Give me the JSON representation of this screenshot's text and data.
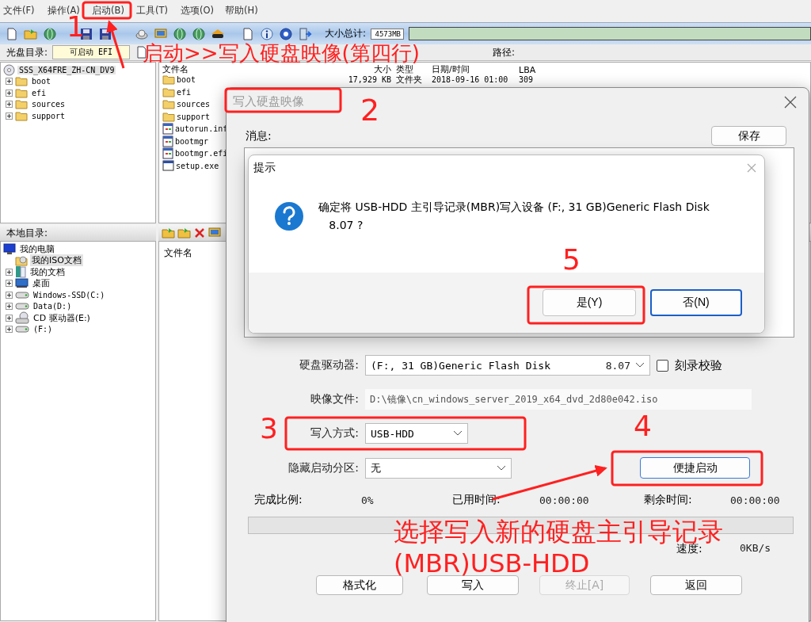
{
  "menu": [
    {
      "label": "文件(F)"
    },
    {
      "label": "操作(A)"
    },
    {
      "label": "启动(B)"
    },
    {
      "label": "工具(T)"
    },
    {
      "label": "选项(O)"
    },
    {
      "label": "帮助(H)"
    }
  ],
  "toolbar": {
    "size_label": "大小总计:",
    "size_value": "4573MB"
  },
  "cd_bar": {
    "label": "光盘目录:",
    "value": "可启动 EFI",
    "path_label": "路径:"
  },
  "iso_tree": [
    {
      "label": "SSS_X64FRE_ZH-CN_DV9",
      "kind": "cd",
      "expandable": false,
      "selected": true,
      "children": [
        {
          "label": "boot",
          "kind": "folder",
          "expandable": true,
          "selected": false
        },
        {
          "label": "efi",
          "kind": "folder",
          "expandable": true,
          "selected": false
        },
        {
          "label": "sources",
          "kind": "folder",
          "expandable": true,
          "selected": false
        },
        {
          "label": "support",
          "kind": "folder",
          "expandable": true,
          "selected": false
        }
      ]
    }
  ],
  "iso_files": {
    "columns": [
      "文件名",
      "大小",
      "类型",
      "日期/时间",
      "LBA"
    ],
    "rows": [
      {
        "name": "boot",
        "kind": "folder",
        "size": "17,929 KB",
        "type": "文件夹",
        "date": "2018-09-16 01:00",
        "lba": "309"
      },
      {
        "name": "efi",
        "kind": "folder"
      },
      {
        "name": "sources",
        "kind": "folder"
      },
      {
        "name": "support",
        "kind": "folder"
      },
      {
        "name": "autorun.inf",
        "kind": "file"
      },
      {
        "name": "bootmgr",
        "kind": "file"
      },
      {
        "name": "bootmgr.efi",
        "kind": "file"
      },
      {
        "name": "setup.exe",
        "kind": "app"
      }
    ]
  },
  "local": {
    "label": "本地目录:",
    "tree": [
      {
        "label": "我的电脑",
        "kind": "computer",
        "expandable": false,
        "selected": false,
        "children": [
          {
            "label": "我的ISO文档",
            "kind": "iso-folder",
            "expandable": false,
            "selected": true
          },
          {
            "label": "我的文档",
            "kind": "documents",
            "expandable": true,
            "selected": false
          },
          {
            "label": "桌面",
            "kind": "desktop",
            "expandable": true,
            "selected": false
          },
          {
            "label": "Windows-SSD(C:)",
            "kind": "drive",
            "expandable": true,
            "selected": false
          },
          {
            "label": "Data(D:)",
            "kind": "drive",
            "expandable": true,
            "selected": false
          },
          {
            "label": "CD 驱动器(E:)",
            "kind": "cd-drive",
            "expandable": true,
            "selected": false
          },
          {
            "label": "(F:)",
            "kind": "drive",
            "expandable": true,
            "selected": false
          }
        ]
      }
    ],
    "files_column": "文件名"
  },
  "write_dialog": {
    "title": "写入硬盘映像",
    "message_label": "消息:",
    "save_button": "保存",
    "disk_drive": {
      "label": "硬盘驱动器:",
      "value": "(F:, 31 GB)Generic Flash Disk",
      "version": "8.07"
    },
    "verify": {
      "label": "刻录校验",
      "checked": false
    },
    "image_file": {
      "label": "映像文件:",
      "value": "D:\\镜像\\cn_windows_server_2019_x64_dvd_2d80e042.iso"
    },
    "write_method": {
      "label": "写入方式:",
      "value": "USB-HDD"
    },
    "hidden_partition": {
      "label": "隐藏启动分区:",
      "value": "无"
    },
    "quick_boot": "便捷启动",
    "progress": {
      "done_label": "完成比例:",
      "done_value": "0%",
      "elapsed_label": "已用时间:",
      "elapsed_value": "00:00:00",
      "remaining_label": "剩余时间:",
      "remaining_value": "00:00:00",
      "level": 0,
      "speed_label": "速度:",
      "speed_value": "0KB/s"
    },
    "buttons": [
      {
        "label": "格式化",
        "disabled": false
      },
      {
        "label": "写入",
        "disabled": false
      },
      {
        "label": "终止[A]",
        "disabled": true
      },
      {
        "label": "返回",
        "disabled": false
      }
    ]
  },
  "confirm_dialog": {
    "title": "提示",
    "message": "确定将 USB-HDD 主引导记录(MBR)写入设备 (F:, 31 GB)Generic Flash Disk\n   8.07 ?",
    "buttons": [
      {
        "label": "是(Y)",
        "focused": false
      },
      {
        "label": "否(N)",
        "focused": true
      }
    ]
  },
  "annotations": {
    "steps": [
      "1",
      "2",
      "3",
      "4",
      "5"
    ],
    "notes": [
      "启动>>写入硬盘映像(第四行)",
      "选择写入新的硬盘主引导记录",
      "(MBR)USB-HDD"
    ]
  }
}
